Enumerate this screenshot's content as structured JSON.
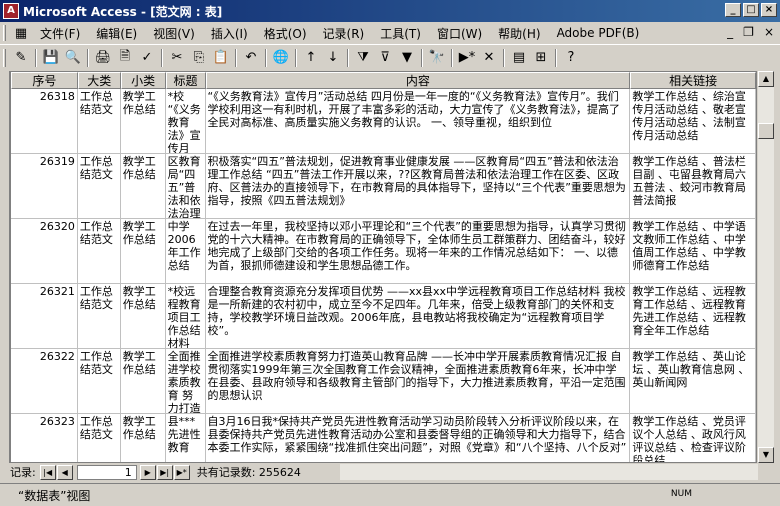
{
  "window": {
    "title": "Microsoft Access - [范文网 : 表]",
    "icon_label": "A"
  },
  "menubar": {
    "items": [
      "文件(F)",
      "编辑(E)",
      "视图(V)",
      "插入(I)",
      "格式(O)",
      "记录(R)",
      "工具(T)",
      "窗口(W)",
      "帮助(H)",
      "Adobe PDF(B)"
    ]
  },
  "columns": {
    "id": "序号",
    "cat1": "大类",
    "cat2": "小类",
    "title": "标题",
    "content": "内容",
    "links": "相关链接"
  },
  "rows": [
    {
      "id": "26318",
      "cat1": "工作总结范文",
      "cat2": "教学工作总结",
      "title": "*校 “《义务教育法》宣传月",
      "content": "“《义务教育法》宣传月”活动总结 四月份是一年一度的“《义务教育法》宣传月”。我们学校利用这一有利时机，开展了丰富多彩的活动，大力宣传了《义务教育法》，提高了全民对高标准、高质量实施义务教育的认识。 一、领导重视，组织到位",
      "links": "教学工作总结 、综治宣传月活动总结 、敬老宣传月活动总结 、法制宣传月活动总结"
    },
    {
      "id": "26319",
      "cat1": "工作总结范文",
      "cat2": "教学工作总结",
      "title": "区教育局“四五”普法和依法治理",
      "content": "积极落实“四五”普法规划，促进教育事业健康发展 ——区教育局“四五”普法和依法治理工作总结 “四五”普法工作开展以来，??区教育局普法和依法治理工作在区委、区政府、区普法办的直接领导下，在市教育局的具体指导下，坚持以“三个代表”重要思想为指导，按照《四五普法规划》",
      "links": "教学工作总结 、普法栏目副 、屯留县教育局六五普法 、蛟河市教育局普法简报"
    },
    {
      "id": "26320",
      "cat1": "工作总结范文",
      "cat2": "教学工作总结",
      "title": "中学2006年工作总结",
      "content": "在过去一年里，我校坚持以邓小平理论和“三个代表”的重要思想为指导，认真学习贯彻党的十六大精神。在市教育局的正确领导下，全体师生员工群策群力、团结奋斗，较好地完成了上级部门交给的各项工作任务。现将一年来的工作情况总结如下： 一、以德为首，狠抓师德建设和学生思想品德工作。",
      "links": "教学工作总结 、中学语文教师工作总结 、中学值周工作总结 、中学教师德育工作总结"
    },
    {
      "id": "26321",
      "cat1": "工作总结范文",
      "cat2": "教学工作总结",
      "title": "*校远程教育项目工作总结材料",
      "content": "合理整合教育资源充分发挥项目优势 ——xx县xx中学远程教育项目工作总结材料 我校是一所新建的农村初中，成立至今不足四年。几年来，倍受上级教育部门的关怀和支持，学校教学环境日益改观。2006年底，县电教站将我校确定为“远程教育项目学校”。",
      "links": "教学工作总结 、远程教育工作总结 、远程教育先进工作总结 、远程教育全年工作总结"
    },
    {
      "id": "26322",
      "cat1": "工作总结范文",
      "cat2": "教学工作总结",
      "title": "全面推进学校素质教育 努力打造",
      "content": "全面推进学校素质教育努力打造英山教育品牌 ——长冲中学开展素质教育情况汇报 自贯彻落实1999年第三次全国教育工作会议精神，全面推进素质教育6年来，长冲中学在县委、县政府领导和各级教育主管部门的指导下，大力推进素质教育，平沿一定范围的思想认识",
      "links": "教学工作总结 、英山论坛 、英山教育信息网 、英山新闻网"
    },
    {
      "id": "26323",
      "cat1": "工作总结范文",
      "cat2": "教学工作总结",
      "title": "县***先进性教育",
      "content": "自3月16日我*保持共产党员先进性教育活动学习动员阶段转入分析评议阶段以来，在县委保持共产党员先进性教育活动办公室和县委督导组的正确领导和大力指导下，结合本委工作实际，紧紧围绕“找准抓住突出问题”，对照《党章》和“八个坚持、八个反对”",
      "links": "教学工作总结 、党员评议个人总结 、政风行风评议总结 、检查评议阶段总结"
    }
  ],
  "navbar": {
    "record_label": "记录:",
    "current_record": "1",
    "total_label": "共有记录数: 255624"
  },
  "status": {
    "view_label": "“数据表”视图",
    "num_indicator": "NUM"
  }
}
